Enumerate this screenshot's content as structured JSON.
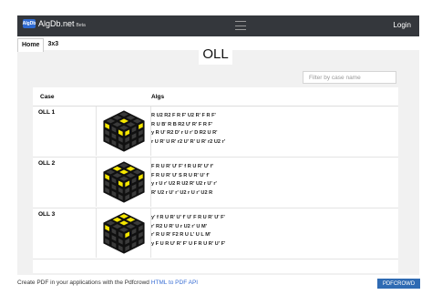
{
  "brand": {
    "name": "AlgDb.net",
    "logo_text": "AlgDb",
    "badge": "Beta"
  },
  "nav": {
    "login": "Login"
  },
  "tabs": [
    {
      "label": "Home"
    },
    {
      "label": "3x3"
    }
  ],
  "page": {
    "title": "OLL"
  },
  "filter": {
    "placeholder": "Filter by case name"
  },
  "table": {
    "headers": {
      "case": "Case",
      "algs": "Algs"
    },
    "rows": [
      {
        "name": "OLL 1",
        "algs": [
          "R U2 R2 F R F' U2 R' F R F'",
          "R U B' R B R2 U' R' F R F'",
          "y R U' R2 D' r U r' D R2 U R'",
          "r U R' U R' r2 U' R' U R' r2 U2 r'"
        ]
      },
      {
        "name": "OLL 2",
        "algs": [
          "F R U R' U' F' f R U R' U' f'",
          "F R U R' U' S R U R' U' f'",
          "y r U r' U2 R U2 R' U2 r U' r'",
          "R' U2 r U' r' U2 r U r' U2 R"
        ]
      },
      {
        "name": "OLL 3",
        "algs": [
          "y' f R U R' U' f' U' F R U R' U' F'",
          "r' R2 U R' U r U2 r' U M'",
          "r' R U R' F2 R U L' U L M'",
          "y F U R U' R' F' U F R U R' U' F'"
        ]
      }
    ]
  },
  "pdf": {
    "text": "Create PDF in your applications with the Pdfcrowd",
    "link": "HTML to PDF API",
    "button": "PDFCROWD"
  },
  "colors": {
    "navbar": "#34373c",
    "sticker_yellow": "#f5e600",
    "sticker_dark": "#3a3a3a"
  }
}
